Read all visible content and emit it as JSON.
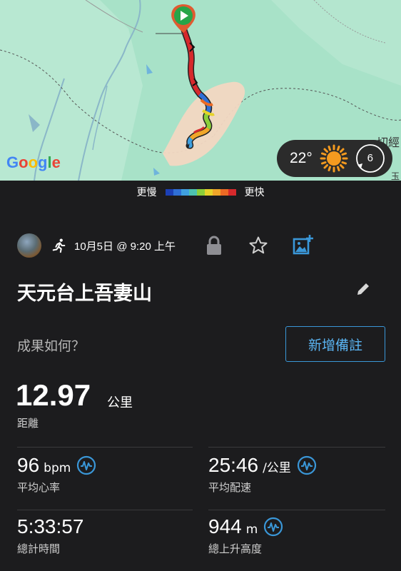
{
  "map": {
    "provider_logo": [
      "G",
      "o",
      "o",
      "g",
      "l",
      "e"
    ],
    "provider_logo_colors": [
      "#4285F4",
      "#EA4335",
      "#FBBC05",
      "#4285F4",
      "#34A853",
      "#EA4335"
    ],
    "corner_text": "一切經",
    "corner_text2": "玉",
    "weather": {
      "temperature": "22°",
      "condition_icon": "sun-icon",
      "wind_speed": "6"
    }
  },
  "legend": {
    "slower_label": "更慢",
    "faster_label": "更快",
    "colors": [
      "#1b3fb5",
      "#2f6fd6",
      "#3fa0e0",
      "#4dc3b0",
      "#8ccf3a",
      "#e6d32a",
      "#f0a629",
      "#ec6a24",
      "#d6292c"
    ]
  },
  "activity": {
    "activity_icon": "running-icon",
    "date": "10月5日 @ 9:20 上午",
    "title": "天元台上吾妻山",
    "prompt": "成果如何？",
    "add_note_label": "新增備註"
  },
  "distance": {
    "value": "12.97",
    "unit": "公里",
    "label": "距離"
  },
  "stats": [
    {
      "value": "96",
      "unit": "bpm",
      "label": "平均心率",
      "has_icon": true
    },
    {
      "value": "25:46",
      "unit": "/公里",
      "label": "平均配速",
      "has_icon": true
    },
    {
      "value": "5:33:57",
      "unit": "",
      "label": "總計時間",
      "has_icon": false
    },
    {
      "value": "944",
      "unit": "m",
      "label": "總上升高度",
      "has_icon": true
    }
  ],
  "colors": {
    "accent": "#3a97d8",
    "background": "#1c1c1e",
    "route": "#d6292c"
  }
}
